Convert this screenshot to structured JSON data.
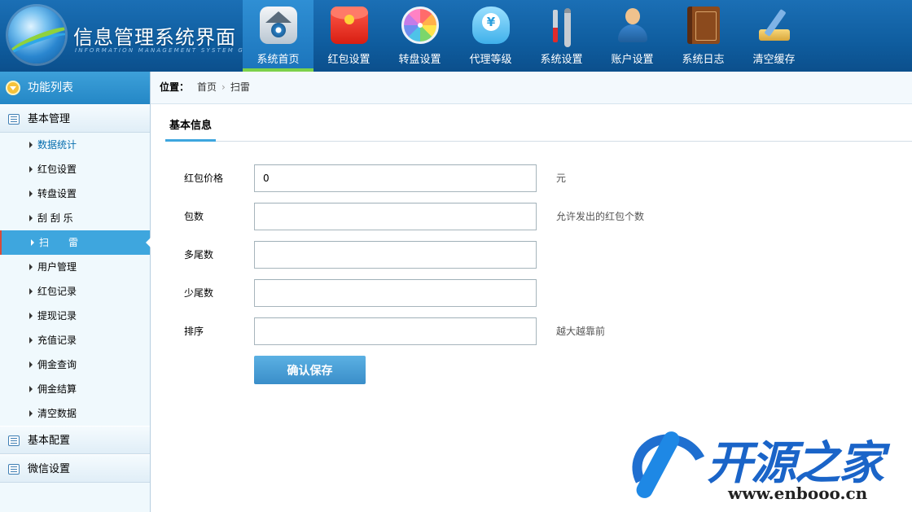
{
  "header": {
    "title": "信息管理系统界面",
    "subtitle": "INFORMATION MANAGEMENT SYSTEM GUI",
    "nav": [
      {
        "label": "系统首页",
        "icon": "home-icon",
        "active": true
      },
      {
        "label": "红包设置",
        "icon": "red-packet-icon"
      },
      {
        "label": "转盘设置",
        "icon": "wheel-icon"
      },
      {
        "label": "代理等级",
        "icon": "yuan-cloud-icon"
      },
      {
        "label": "系统设置",
        "icon": "tools-icon"
      },
      {
        "label": "账户设置",
        "icon": "user-icon"
      },
      {
        "label": "系统日志",
        "icon": "book-icon"
      },
      {
        "label": "清空缓存",
        "icon": "clear-cache-icon"
      }
    ]
  },
  "sidebar": {
    "title": "功能列表",
    "groups": [
      {
        "label": "基本管理"
      },
      {
        "label": "基本配置"
      },
      {
        "label": "微信设置"
      }
    ],
    "items": [
      {
        "label": "数据统计"
      },
      {
        "label": "红包设置"
      },
      {
        "label": "转盘设置"
      },
      {
        "label": "刮 刮 乐"
      },
      {
        "label": "扫　　雷"
      },
      {
        "label": "用户管理"
      },
      {
        "label": "红包记录"
      },
      {
        "label": "提现记录"
      },
      {
        "label": "充值记录"
      },
      {
        "label": "佣金查询"
      },
      {
        "label": "佣金结算"
      },
      {
        "label": "清空数据"
      }
    ]
  },
  "breadcrumb": {
    "prefix": "位置：",
    "items": [
      "首页",
      "扫雷"
    ],
    "separator": "›"
  },
  "tab": {
    "label": "基本信息"
  },
  "form": {
    "fields": [
      {
        "label": "红包价格",
        "value": "0",
        "hint": "元"
      },
      {
        "label": "包数",
        "value": "",
        "hint": "允许发出的红包个数"
      },
      {
        "label": "多尾数",
        "value": "",
        "hint": ""
      },
      {
        "label": "少尾数",
        "value": "",
        "hint": ""
      },
      {
        "label": "排序",
        "value": "",
        "hint": "越大越靠前"
      }
    ],
    "save_label": "确认保存"
  },
  "watermark": {
    "text": "开源之家",
    "url": "www.enbooo.cn"
  },
  "colors": {
    "header_bg": "#0f5d9f",
    "accent": "#3ea6de",
    "active_nav_underline": "#7cd14a",
    "sidebar_bg": "#f0f9fd"
  }
}
